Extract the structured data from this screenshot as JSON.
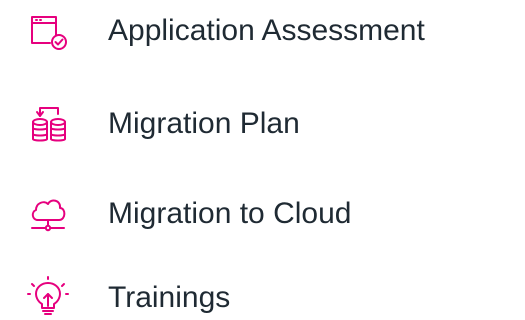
{
  "theme": {
    "accent_color": "#e6007e",
    "text_color": "#1f2a33"
  },
  "menu": {
    "items": [
      {
        "label": "Application Assessment",
        "icon": "browser-window-check-icon"
      },
      {
        "label": "Migration Plan",
        "icon": "database-migration-icon"
      },
      {
        "label": "Migration to Cloud",
        "icon": "cloud-network-icon"
      },
      {
        "label": "Trainings",
        "icon": "lightbulb-icon"
      }
    ]
  }
}
